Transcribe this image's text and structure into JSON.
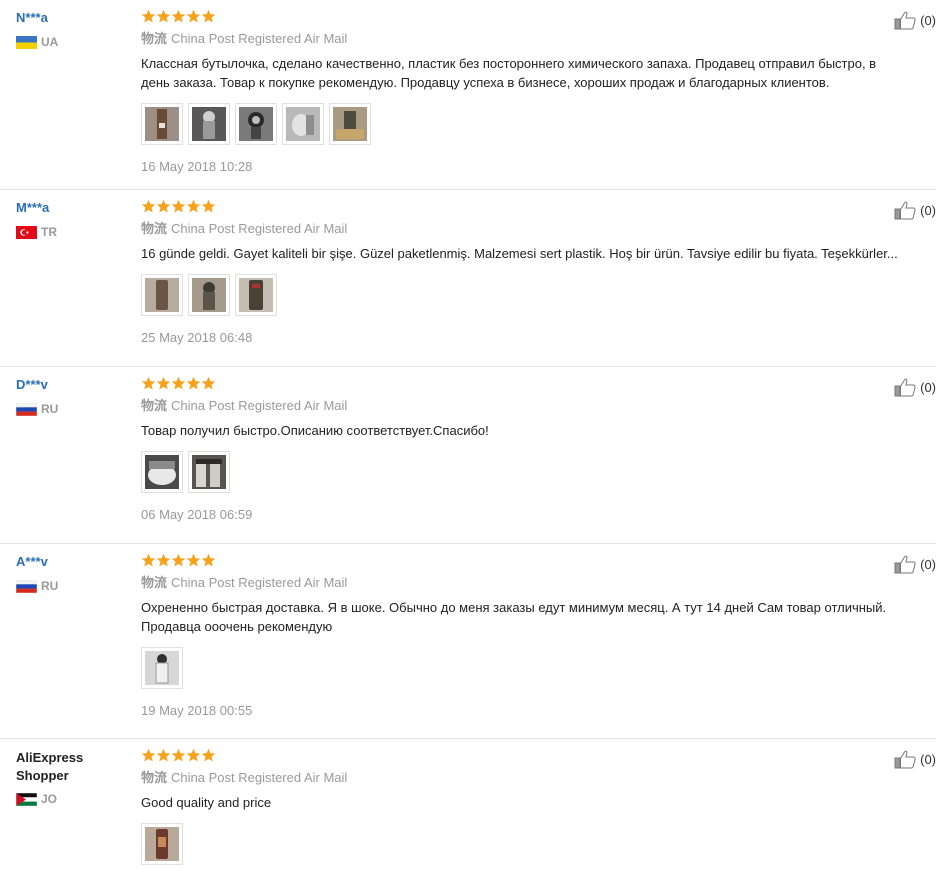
{
  "logistics_label_zh": "物流",
  "logistics_service": "China Post Registered Air Mail",
  "reviews": [
    {
      "user": "N***a",
      "country": "UA",
      "text": "Классная бутылочка, сделано качественно, пластик без постороннего химического запаха. Продавец отправил быстро, в день заказа. Товар к покупке рекомендую. Продавцу успеха в бизнесе, хороших продаж и благодарных клиентов.",
      "date": "16 May 2018 10:28",
      "helpful": "(0)"
    },
    {
      "user": "M***a",
      "country": "TR",
      "text": "16 günde geldi. Gayet kaliteli bir şişe. Güzel paketlenmiş. Malzemesi sert plastik. Hoş bir ürün. Tavsiye edilir bu fiyata. Teşekkürler...",
      "date": "25 May 2018 06:48",
      "helpful": "(0)"
    },
    {
      "user": "D***v",
      "country": "RU",
      "text": "Товар получил быстро.Описанию соответствует.Спасибо!",
      "date": "06 May 2018 06:59",
      "helpful": "(0)"
    },
    {
      "user": "A***v",
      "country": "RU",
      "text": "Охрененно быстрая доставка. Я в шоке. Обычно до меня заказы едут минимум месяц. А тут 14 дней Сам товар отличный. Продавца ооочень рекомендую",
      "date": "19 May 2018 00:55",
      "helpful": "(0)"
    },
    {
      "user": "AliExpress Shopper",
      "country": "JO",
      "text": "Good quality and price",
      "date": "",
      "helpful": "(0)"
    }
  ]
}
